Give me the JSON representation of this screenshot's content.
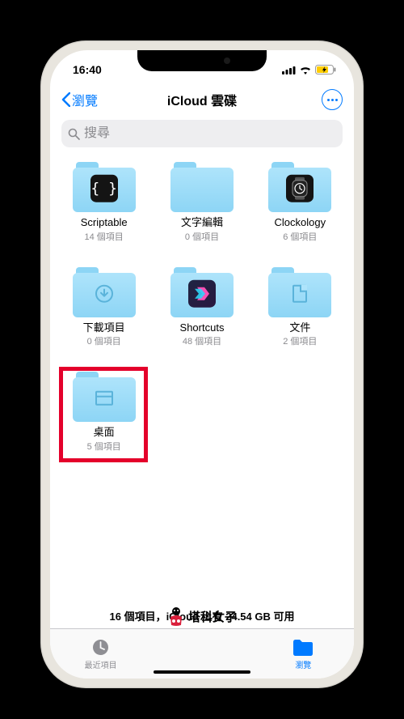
{
  "status": {
    "time": "16:40"
  },
  "nav": {
    "back_label": "瀏覽",
    "title": "iCloud 雲碟"
  },
  "search": {
    "placeholder": "搜尋"
  },
  "folders": [
    {
      "name": "Scriptable",
      "sub": "14 個項目",
      "badge": "scriptable"
    },
    {
      "name": "文字編輯",
      "sub": "0 個項目",
      "badge": "none"
    },
    {
      "name": "Clockology",
      "sub": "6 個項目",
      "badge": "clockology"
    },
    {
      "name": "下載項目",
      "sub": "0 個項目",
      "badge": "download"
    },
    {
      "name": "Shortcuts",
      "sub": "48 個項目",
      "badge": "shortcuts"
    },
    {
      "name": "文件",
      "sub": "2 個項目",
      "badge": "document"
    },
    {
      "name": "桌面",
      "sub": "5 個項目",
      "badge": "desktop",
      "highlighted": true
    }
  ],
  "footer": "16 個項目，iCloud 上有 24.54 GB 可用",
  "tabs": {
    "recent": "最近項目",
    "browse": "瀏覽"
  },
  "watermark": "塔科女子"
}
